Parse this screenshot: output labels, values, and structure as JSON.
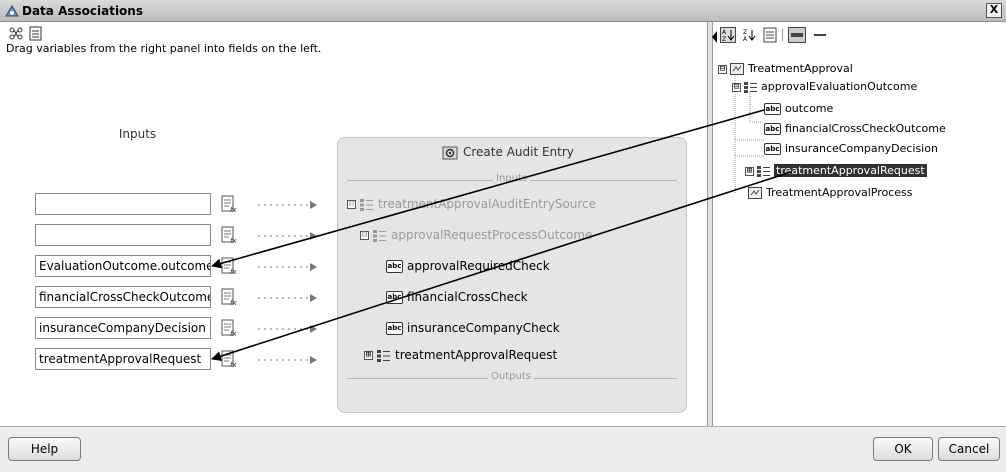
{
  "window": {
    "title": "Data Associations",
    "close_glyph": "X"
  },
  "left_panel": {
    "hint": "Drag variables from the right panel into fields on the left.",
    "inputs_label": "Inputs",
    "fields": [
      {
        "value": ""
      },
      {
        "value": ""
      },
      {
        "value": "EvaluationOutcome.outcome"
      },
      {
        "value": "financialCrossCheckOutcome"
      },
      {
        "value": "insuranceCompanyDecision"
      },
      {
        "value": "treatmentApprovalRequest"
      }
    ]
  },
  "audit": {
    "title": "Create Audit Entry",
    "inputs_sep": "Inputs",
    "outputs_sep": "Outputs",
    "nodes": [
      {
        "label": "treatmentApprovalAuditEntrySource",
        "expander": "⊟"
      },
      {
        "label": "approvalRequestProcessOutcome",
        "expander": "⊟"
      },
      {
        "label": "approvalRequiredCheck",
        "icon_text": "abc"
      },
      {
        "label": "financialCrossCheck",
        "icon_text": "abc"
      },
      {
        "label": "insuranceCompanyCheck",
        "icon_text": "abc"
      },
      {
        "label": "treatmentApprovalRequest",
        "expander": "⊞"
      }
    ]
  },
  "right_tree": {
    "nodes": [
      {
        "label": "TreatmentApproval",
        "expander": "⊟"
      },
      {
        "label": "approvalEvaluationOutcome",
        "expander": "⊟"
      },
      {
        "label": "outcome",
        "icon_text": "abc"
      },
      {
        "label": "financialCrossCheckOutcome",
        "icon_text": "abc"
      },
      {
        "label": "insuranceCompanyDecision",
        "icon_text": "abc"
      },
      {
        "label": "treatmentApprovalRequest",
        "expander": "⊞",
        "selected": true
      },
      {
        "label": "TreatmentApprovalProcess"
      }
    ]
  },
  "buttons": {
    "help": "Help",
    "ok": "OK",
    "cancel": "Cancel"
  },
  "icons": {
    "app": "data-associations-icon",
    "toolbar_left": [
      "connect-icon",
      "document-icon"
    ],
    "toolbar_right": [
      "sort-ascending-icon",
      "sort-descending-icon",
      "list-icon",
      "layout-icon",
      "collapse-icon"
    ]
  },
  "colors": {
    "selection": "#303030",
    "panel": "#e5e5e5"
  }
}
